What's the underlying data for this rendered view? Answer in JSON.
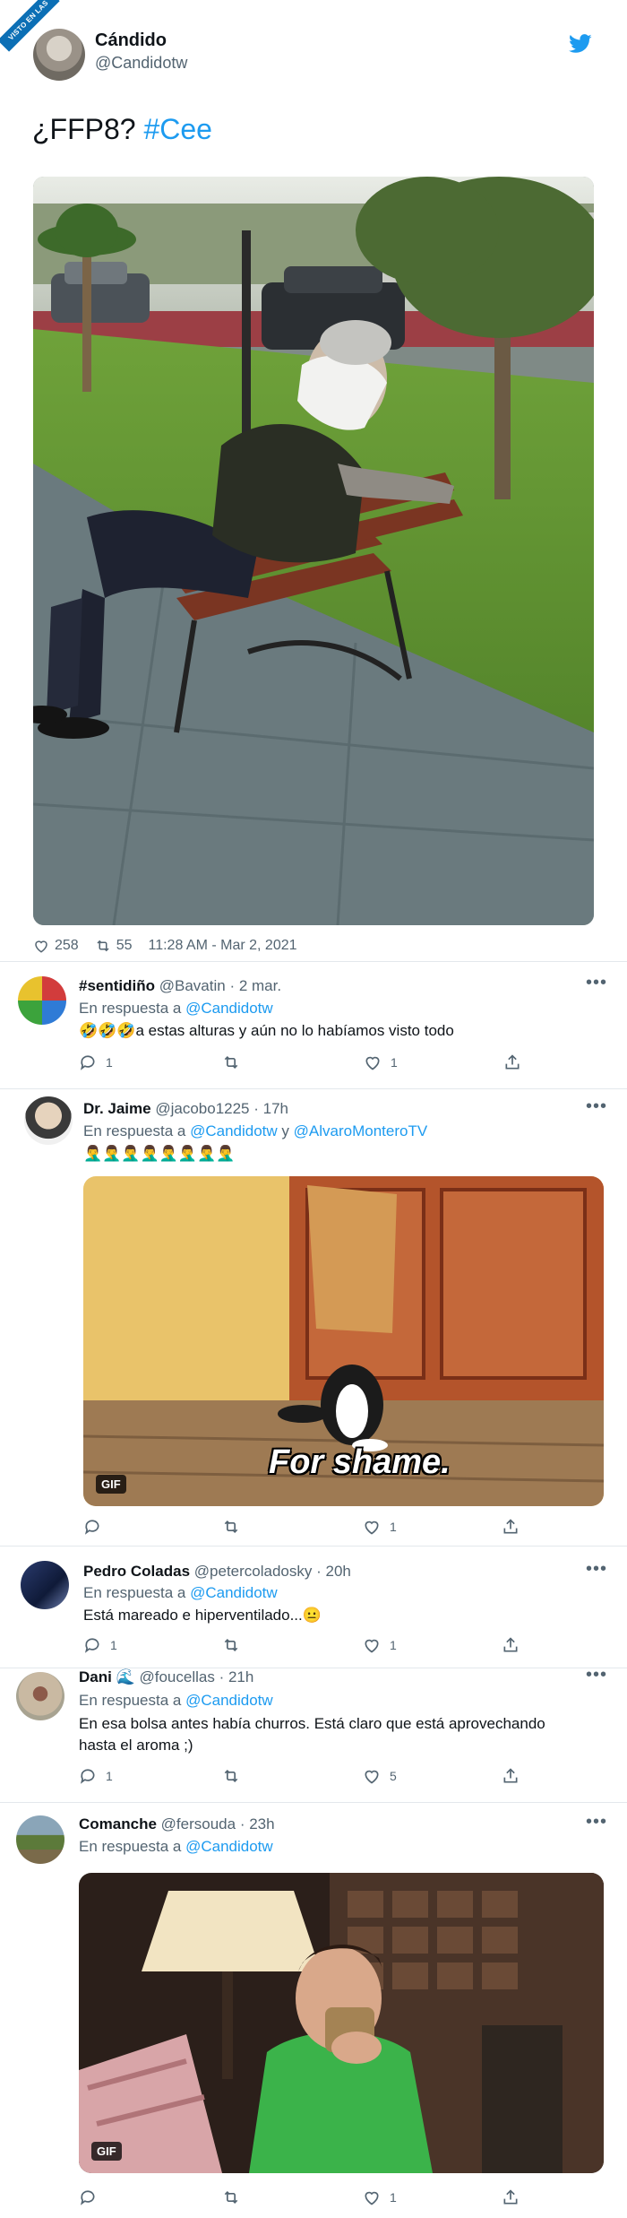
{
  "watermark": {
    "text": "VISTO EN LAS REDES .COM"
  },
  "main_tweet": {
    "author_name": "Cándido",
    "author_handle": "@Candidotw",
    "text_plain": "¿FFP8? ",
    "hashtag": "#Cee",
    "likes": "258",
    "retweets": "55",
    "timestamp": "11:28 AM - Mar 2, 2021"
  },
  "replies": [
    {
      "name": "#sentidiño",
      "handle": "@Bavatin",
      "time": "· 2 mar.",
      "reply_prefix": "En respuesta a",
      "reply_to": "@Candidotw",
      "reply_to_extra": "",
      "text": "🤣🤣🤣a estas alturas y aún no lo habíamos visto todo",
      "reply_count": "1",
      "retweet_count": "",
      "like_count": "1"
    },
    {
      "name": "Dr. Jaime",
      "handle": "@jacobo1225",
      "time": "· 17h",
      "reply_prefix": "En respuesta a",
      "reply_to": "@Candidotw",
      "reply_and": "y",
      "reply_to_extra": "@AlvaroMonteroTV",
      "text": "🤦‍♂️🤦‍♂️🤦‍♂️🤦‍♂️🤦‍♂️🤦‍♂️🤦‍♂️🤦‍♂️",
      "gif_label": "GIF",
      "gif_caption": "For shame.",
      "reply_count": "",
      "retweet_count": "",
      "like_count": "1"
    },
    {
      "name": "Pedro Coladas",
      "handle": "@petercoladosky",
      "time": "· 20h",
      "reply_prefix": "En respuesta a",
      "reply_to": "@Candidotw",
      "text": "Está mareado e hiperventilado...😐",
      "reply_count": "1",
      "retweet_count": "",
      "like_count": "1"
    },
    {
      "name": "Dani 🌊",
      "handle": "@foucellas",
      "time": "· 21h",
      "reply_prefix": "En respuesta a",
      "reply_to": "@Candidotw",
      "text_line1": "En esa bolsa antes había churros. Está claro que está aprovechando",
      "text_line2": "hasta el aroma ;)",
      "reply_count": "1",
      "retweet_count": "",
      "like_count": "5"
    },
    {
      "name": "Comanche",
      "handle": "@fersouda",
      "time": "· 23h",
      "reply_prefix": "En respuesta a",
      "reply_to": "@Candidotw",
      "gif_label": "GIF",
      "reply_count": "",
      "retweet_count": "",
      "like_count": "1"
    }
  ],
  "icons": {
    "reply": "reply-icon",
    "retweet": "retweet-icon",
    "like": "heart-icon",
    "share": "share-icon",
    "more": "more-icon",
    "brand": "twitter-bird-icon"
  },
  "colors": {
    "link": "#1d9bf0",
    "muted": "#536471",
    "text": "#0f1419",
    "divider": "#e3e8ec"
  }
}
